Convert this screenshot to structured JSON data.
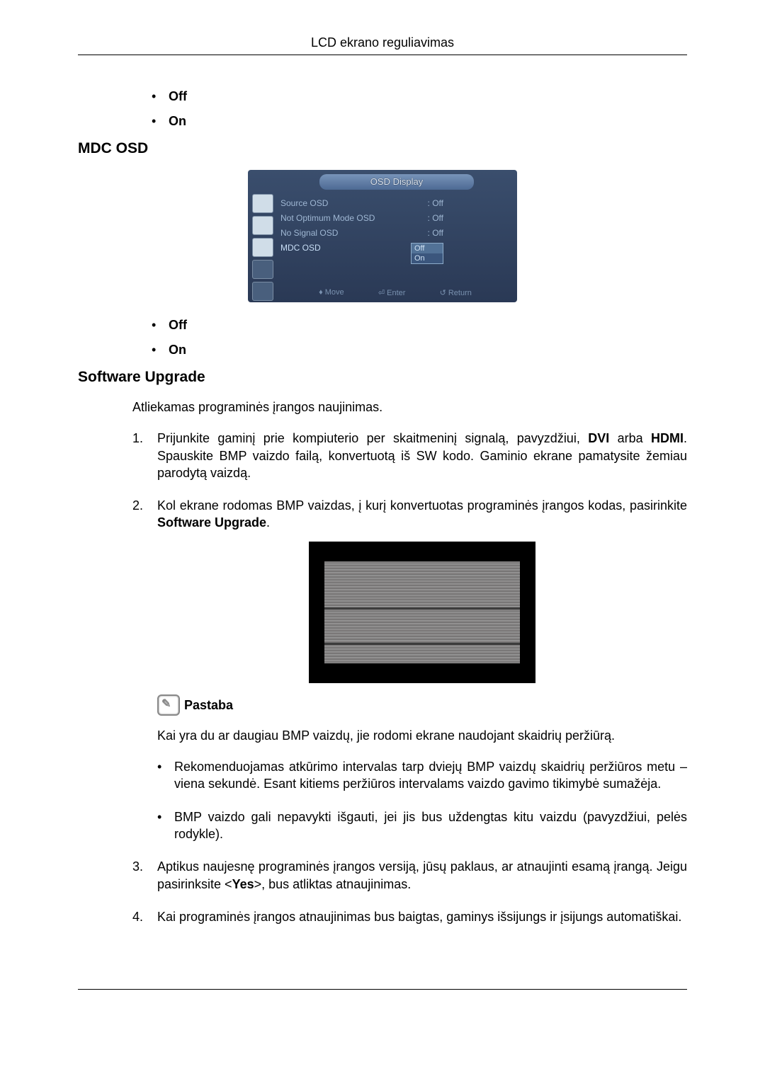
{
  "header": {
    "title": "LCD ekrano reguliavimas"
  },
  "list_off_on_1": {
    "off": "Off",
    "on": "On"
  },
  "section1": {
    "heading": "MDC OSD"
  },
  "osd": {
    "title": "OSD Display",
    "rows": [
      {
        "label": "Source OSD",
        "value": ": Off"
      },
      {
        "label": "Not Optimum Mode OSD",
        "value": ": Off"
      },
      {
        "label": "No Signal OSD",
        "value": ": Off"
      },
      {
        "label": "MDC OSD",
        "value": ""
      }
    ],
    "dropdown": {
      "opt1": "Off",
      "opt2": "On"
    },
    "footer": {
      "move": "Move",
      "enter": "Enter",
      "return": "Return"
    }
  },
  "list_off_on_2": {
    "off": "Off",
    "on": "On"
  },
  "section2": {
    "heading": "Software Upgrade",
    "intro": "Atliekamas programinės įrangos naujinimas.",
    "step1_a": "Prijunkite gaminį prie kompiuterio per skaitmeninį signalą, pavyzdžiui, ",
    "step1_dvi": "DVI",
    "step1_b": " arba ",
    "step1_hdmi": "HDMI",
    "step1_c": ". Spauskite BMP vaizdo failą, konvertuotą iš SW kodo. Gaminio ekrane pamatysite žemiau parodytą vaizdą.",
    "step2_a": "Kol ekrane rodomas BMP vaizdas, į kurį konvertuotas programinės įrangos kodas, pasirinkite ",
    "step2_bold": "Software Upgrade",
    "step2_b": ".",
    "note_label": "Pastaba",
    "note_intro": "Kai yra du ar daugiau BMP vaizdų, jie rodomi ekrane naudojant skaidrių peržiūrą.",
    "note_b1": "Rekomenduojamas atkūrimo intervalas tarp dviejų BMP vaizdų skaidrių peržiūros metu – viena sekundė. Esant kitiems peržiūros intervalams vaizdo gavimo tikimybė sumažėja.",
    "note_b2": "BMP vaizdo gali nepavykti išgauti, jei jis bus uždengtas kitu vaizdu (pavyzdžiui, pelės rodykle).",
    "step3_a": "Aptikus naujesnę programinės įrangos versiją, jūsų paklaus, ar atnaujinti esamą įrangą. Jeigu pasirinksite <",
    "step3_yes": "Yes",
    "step3_b": ">, bus atliktas atnaujinimas.",
    "step4": "Kai programinės įrangos atnaujinimas bus baigtas, gaminys išsijungs ir įsijungs automatiškai."
  }
}
